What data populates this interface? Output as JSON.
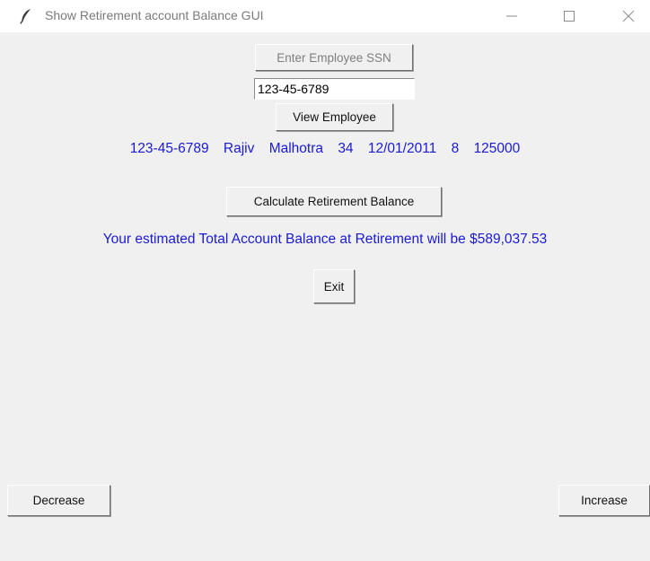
{
  "window": {
    "title": "Show Retirement account Balance GUI",
    "icon": "feather-icon",
    "controls": {
      "minimize_icon": "minimize-icon",
      "maximize_icon": "maximize-icon",
      "close_icon": "close-icon"
    }
  },
  "form": {
    "enter_ssn_label": "Enter Employee SSN",
    "ssn_value": "123-45-6789",
    "view_employee_label": "View Employee",
    "calculate_label": "Calculate Retirement Balance",
    "exit_label": "Exit",
    "decrease_label": "Decrease",
    "increase_label": "Increase"
  },
  "employee": {
    "ssn": "123-45-6789",
    "first_name": "Rajiv",
    "last_name": "Malhotra",
    "age": "34",
    "start_date": "12/01/2011",
    "value_8": "8",
    "salary": "125000"
  },
  "result": {
    "message": "Your estimated Total Account Balance at Retirement will be $589,037.53"
  },
  "colors": {
    "background": "#f0f0f0",
    "info_text": "#1a1ad6",
    "disabled_text": "#7f7f7f"
  }
}
